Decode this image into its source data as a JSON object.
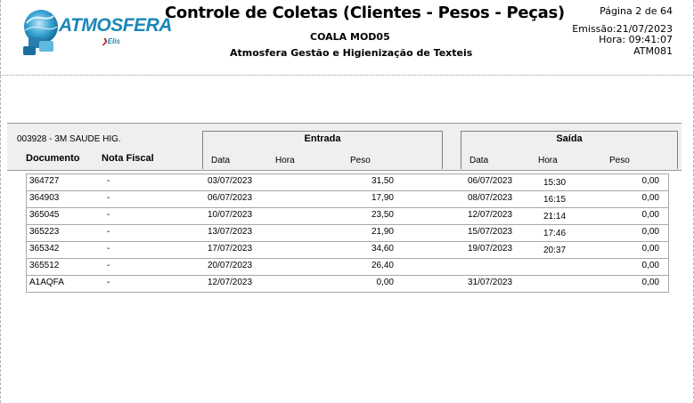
{
  "header": {
    "title": "Controle de Coletas (Clientes - Pesos - Peças)",
    "subtitle1": "COALA MOD05",
    "subtitle2": "Atmosfera Gestão e Higienização de Texteis",
    "page": "Página 2 de 64",
    "emissao": "Emissão:21/07/2023",
    "hora": "Hora: 09:41:07",
    "code": "ATM081"
  },
  "logo": {
    "brand": "ATMOSFERA",
    "sub": "",
    "elis": "Elis",
    "icon": "atmosfera-logo-icon"
  },
  "group": {
    "client": "003928 - 3M SAUDE HIG.",
    "col_documento": "Documento",
    "col_nota_fiscal": "Nota Fiscal",
    "entrada": {
      "title": "Entrada",
      "data": "Data",
      "hora": "Hora",
      "peso": "Peso"
    },
    "saida": {
      "title": "Saída",
      "data": "Data",
      "hora": "Hora",
      "peso": "Peso"
    }
  },
  "rows": [
    {
      "doc": "364727",
      "nf": "-",
      "entrada_data": "03/07/2023",
      "entrada_peso": "31,50",
      "saida_data": "06/07/2023",
      "saida_hora": "15:30",
      "saida_peso": "0,00"
    },
    {
      "doc": "364903",
      "nf": "-",
      "entrada_data": "06/07/2023",
      "entrada_peso": "17,90",
      "saida_data": "08/07/2023",
      "saida_hora": "16:15",
      "saida_peso": "0,00"
    },
    {
      "doc": "365045",
      "nf": "-",
      "entrada_data": "10/07/2023",
      "entrada_peso": "23,50",
      "saida_data": "12/07/2023",
      "saida_hora": "21:14",
      "saida_peso": "0,00"
    },
    {
      "doc": "365223",
      "nf": "-",
      "entrada_data": "13/07/2023",
      "entrada_peso": "21,90",
      "saida_data": "15/07/2023",
      "saida_hora": "17:46",
      "saida_peso": "0,00"
    },
    {
      "doc": "365342",
      "nf": "-",
      "entrada_data": "17/07/2023",
      "entrada_peso": "34,60",
      "saida_data": "19/07/2023",
      "saida_hora": "20:37",
      "saida_peso": "0,00"
    },
    {
      "doc": "365512",
      "nf": "-",
      "entrada_data": "20/07/2023",
      "entrada_peso": "26,40",
      "saida_data": "",
      "saida_hora": "",
      "saida_peso": "0,00"
    },
    {
      "doc": "A1AQFA",
      "nf": "-",
      "entrada_data": "12/07/2023",
      "entrada_peso": "0,00",
      "saida_data": "31/07/2023",
      "saida_hora": "",
      "saida_peso": "0,00"
    }
  ]
}
